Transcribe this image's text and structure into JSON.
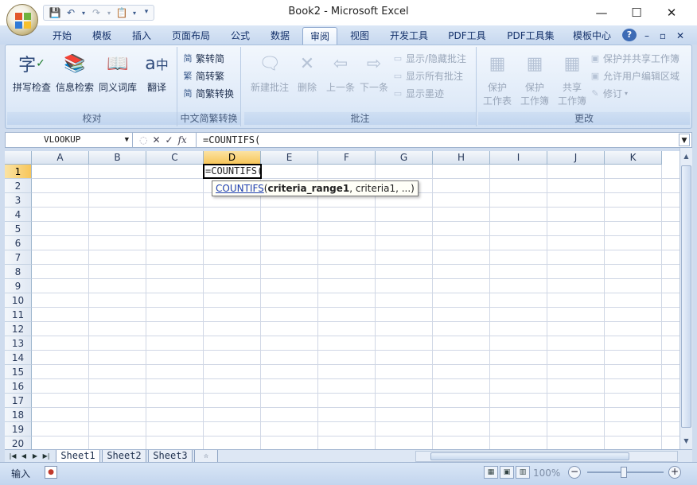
{
  "window": {
    "title": "Book2 - Microsoft Excel",
    "minimize": "—",
    "maximize": "☐",
    "close": "✕"
  },
  "ribbon_tabs": [
    {
      "label": "开始"
    },
    {
      "label": "模板"
    },
    {
      "label": "插入"
    },
    {
      "label": "页面布局"
    },
    {
      "label": "公式"
    },
    {
      "label": "数据"
    },
    {
      "label": "审阅",
      "active": true
    },
    {
      "label": "视图"
    },
    {
      "label": "开发工具"
    },
    {
      "label": "PDF工具"
    },
    {
      "label": "PDF工具集"
    },
    {
      "label": "模板中心"
    }
  ],
  "ribbon_controls": {
    "help": "?",
    "min": "–",
    "restore": "▫",
    "close": "✕"
  },
  "ribbon": {
    "proofing": {
      "label": "校对",
      "spell": "拼写检查",
      "research": "信息检索",
      "thesaurus": "同义词库",
      "translate": "翻译"
    },
    "chinese": {
      "label": "中文简繁转换",
      "to_simplified": "繁转简",
      "to_traditional": "简转繁",
      "convert": "简繁转换"
    },
    "comments": {
      "label": "批注",
      "new": "新建批注",
      "delete": "删除",
      "prev": "上一条",
      "next": "下一条",
      "show_hide": "显示/隐藏批注",
      "show_all": "显示所有批注",
      "show_ink": "显示墨迹"
    },
    "changes": {
      "label": "更改",
      "protect_sheet_1": "保护",
      "protect_sheet_2": "工作表",
      "protect_book_1": "保护",
      "protect_book_2": "工作簿",
      "share_1": "共享",
      "share_2": "工作簿",
      "protect_share": "保护并共享工作簿",
      "allow_edit": "允许用户编辑区域",
      "track": "修订"
    }
  },
  "formula_bar": {
    "name_box": "VLOOKUP",
    "cancel": "✕",
    "enter": "✓",
    "fx": "fx",
    "formula": "=COUNTIFS("
  },
  "grid": {
    "columns": [
      "A",
      "B",
      "C",
      "D",
      "E",
      "F",
      "G",
      "H",
      "I",
      "J",
      "K"
    ],
    "rows": [
      "1",
      "2",
      "3",
      "4",
      "5",
      "6",
      "7",
      "8",
      "9",
      "10",
      "11",
      "12",
      "13",
      "14",
      "15",
      "16",
      "17",
      "18",
      "19",
      "20"
    ],
    "selected_column": "D",
    "selected_row": "1",
    "active_cell_text": "=COUNTIFS(",
    "tooltip": {
      "func": "COUNTIFS",
      "open": "(",
      "arg1": "criteria_range1",
      "rest": ", criteria1, ...)"
    }
  },
  "sheets": [
    {
      "label": "Sheet1",
      "active": true
    },
    {
      "label": "Sheet2"
    },
    {
      "label": "Sheet3"
    }
  ],
  "status": {
    "mode": "输入",
    "zoom": "100%"
  },
  "icons": {
    "office": "office-logo-icon",
    "save": "save-icon",
    "undo": "undo-icon",
    "redo": "redo-icon"
  }
}
